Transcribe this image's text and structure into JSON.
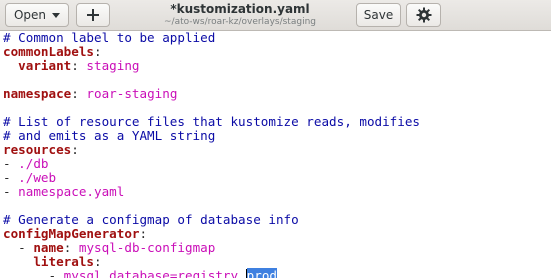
{
  "header": {
    "open_label": "Open",
    "title": "*kustomization.yaml",
    "subtitle": "~/ato-ws/roar-kz/overlays/staging",
    "save_label": "Save",
    "icons": {
      "open_menu": "chevron-down-icon",
      "new_tab": "plus-icon",
      "menu": "gear-icon"
    }
  },
  "editor": {
    "lines": {
      "l1": {
        "comment": "# Common label to be applied"
      },
      "l2": {
        "key": "commonLabels",
        "colon": ":"
      },
      "l3": {
        "indent": "  ",
        "key": "variant",
        "colon": ":",
        "value": " staging"
      },
      "l5": {
        "key": "namespace",
        "colon": ":",
        "value": " roar-staging"
      },
      "l7": {
        "comment": "# List of resource files that kustomize reads, modifies"
      },
      "l8": {
        "comment": "# and emits as a YAML string"
      },
      "l9": {
        "key": "resources",
        "colon": ":"
      },
      "l10": {
        "dash": "- ",
        "value": "./db"
      },
      "l11": {
        "dash": "- ",
        "value": "./web"
      },
      "l12": {
        "dash": "- ",
        "value": "namespace.yaml"
      },
      "l14": {
        "comment": "# Generate a configmap of database info"
      },
      "l15": {
        "key": "configMapGenerator",
        "colon": ":"
      },
      "l16": {
        "indent": "  ",
        "dash": "- ",
        "key": "name",
        "colon": ":",
        "value": " mysql-db-configmap"
      },
      "l17": {
        "indent": "    ",
        "key": "literals",
        "colon": ":"
      },
      "l18": {
        "indent": "      ",
        "dash": "- ",
        "value": "mysql.database=registry_",
        "selected": "prod"
      }
    }
  },
  "colors": {
    "comment": "#0b0ba6",
    "key": "#a01010",
    "value": "#ca0fb8",
    "selection": "#3f80e0"
  }
}
